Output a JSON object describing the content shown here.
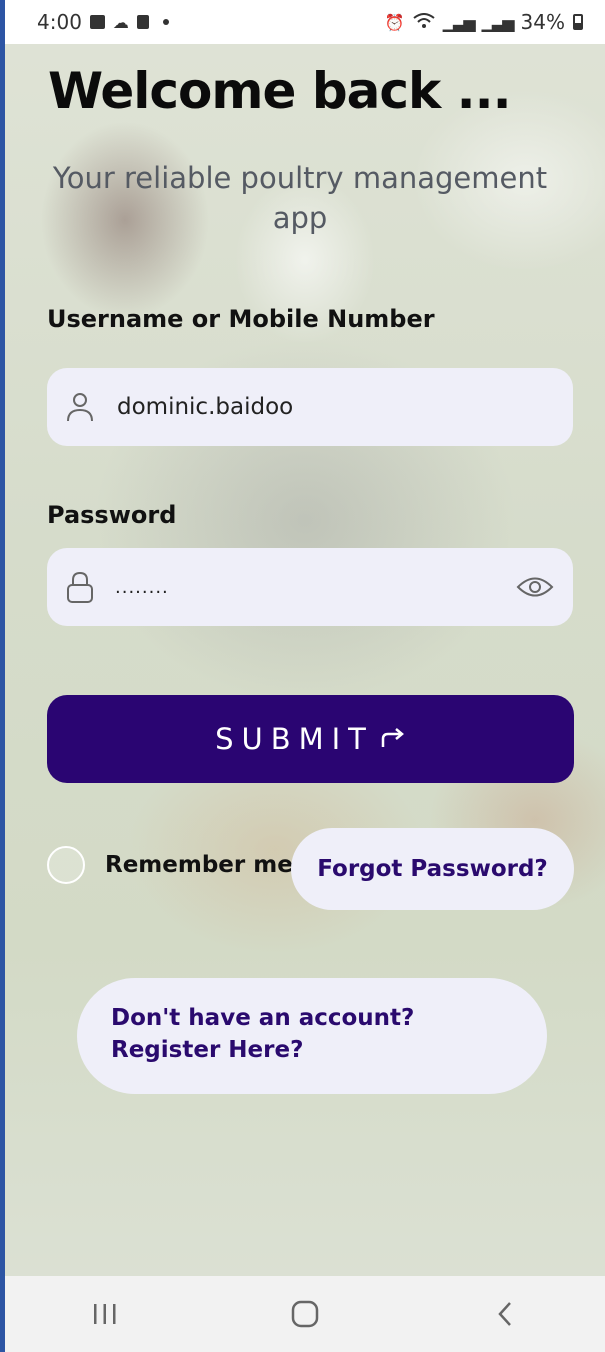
{
  "status_bar": {
    "time": "4:00",
    "battery_percent": "34%",
    "left_icons": [
      "gallery-icon",
      "cloud-icon",
      "sim-icon",
      "notification-dot"
    ],
    "right_icons": [
      "alarm-icon",
      "wifi-icon",
      "signal-icon",
      "signal-icon",
      "battery-icon"
    ]
  },
  "header": {
    "title": "Welcome back ...",
    "subtitle": "Your reliable poultry management app"
  },
  "form": {
    "username_label": "Username or Mobile Number",
    "username_value": "dominic.baidoo",
    "password_label": "Password",
    "password_value": "........",
    "submit_label": "SUBMIT",
    "remember_label": "Remember me",
    "remember_checked": false,
    "forgot_label": "Forgot Password?",
    "register_label": "Don't have an account? Register Here?"
  },
  "colors": {
    "primary": "#2a0572",
    "field_bg": "#efeff9",
    "link_text": "#2a0a6e"
  },
  "nav_bar": {
    "buttons": [
      "recents-icon",
      "home-icon",
      "back-icon"
    ]
  }
}
